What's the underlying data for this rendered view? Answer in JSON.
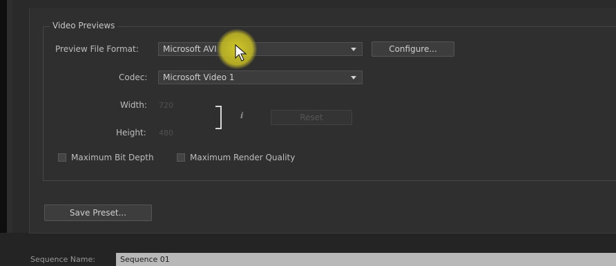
{
  "video_previews": {
    "group_title": "Video Previews",
    "preview_file_format": {
      "label": "Preview File Format:",
      "value": "Microsoft AVI"
    },
    "configure_button": "Configure...",
    "codec": {
      "label": "Codec:",
      "value": "Microsoft Video 1"
    },
    "width": {
      "label": "Width:",
      "value": "720"
    },
    "height": {
      "label": "Height:",
      "value": "480"
    },
    "reset_button": "Reset",
    "maximum_bit_depth": {
      "label": "Maximum Bit Depth",
      "checked": false
    },
    "maximum_render_quality": {
      "label": "Maximum Render Quality",
      "checked": false
    }
  },
  "save_preset_button": "Save Preset...",
  "sequence_name": {
    "label": "Sequence Name:",
    "value": "Sequence 01"
  },
  "colors": {
    "highlight": "#d7cd28",
    "panel_bg": "#2f2f2f"
  }
}
